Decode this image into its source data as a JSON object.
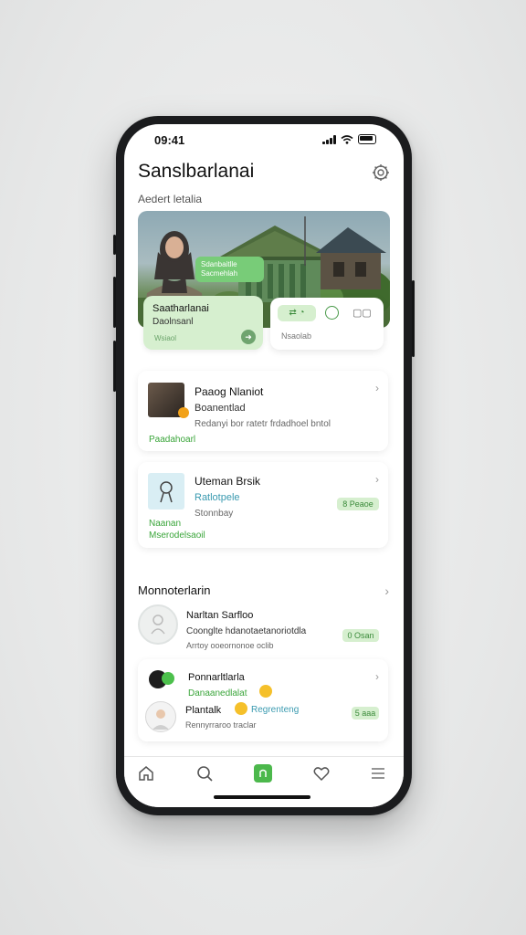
{
  "status": {
    "time": "09:41"
  },
  "header": {
    "title": "Sanslbarlanai",
    "subtitle": "Aedert letalia",
    "action_icon": "settings-icon"
  },
  "hero": {
    "tag_line1": "Sdanbaitlle",
    "tag_line2": "Sacmehlah",
    "card_green": {
      "title": "Saatharlanai",
      "subtitle": "Daolnsanl",
      "caption": "Wsiaol"
    },
    "card_white": {
      "chip": "⇄ ◔",
      "icons": "▢▢",
      "caption": "Nsaolab"
    }
  },
  "cards": [
    {
      "name": "Paaog Nlaniot",
      "sub": "Boanentlad",
      "desc": "Redanyi bor ratetr frdadhoel bntol",
      "tag": "Paadahoarl"
    },
    {
      "name": "Uteman Brsik",
      "sub": "Ratlotpele",
      "desc": "Stonnbay",
      "badge": "8 Peaoe",
      "tag1": "Naanan",
      "tag2": "Mserodelsaoil"
    }
  ],
  "section": {
    "title": "Monnoterlarin",
    "items": [
      {
        "name": "Narltan Sarfloo",
        "line1": "Coonglte hdanotaetanoriotdla",
        "line2": "Arrtoy ooeornonoe oclib",
        "badge": "0 Osan"
      },
      {
        "name": "Ponnarltlarla",
        "line1": "Danaanedlalat",
        "name2": "Plantalk",
        "extra": "Regrenteng",
        "line2": "Rennyrraroo traclar",
        "badge": "5 aaa"
      }
    ]
  },
  "nav": [
    "home-icon",
    "search-icon",
    "add-icon",
    "heart-icon",
    "menu-icon"
  ],
  "colors": {
    "accent": "#4cb84c",
    "soft_green": "#d6efcf"
  }
}
